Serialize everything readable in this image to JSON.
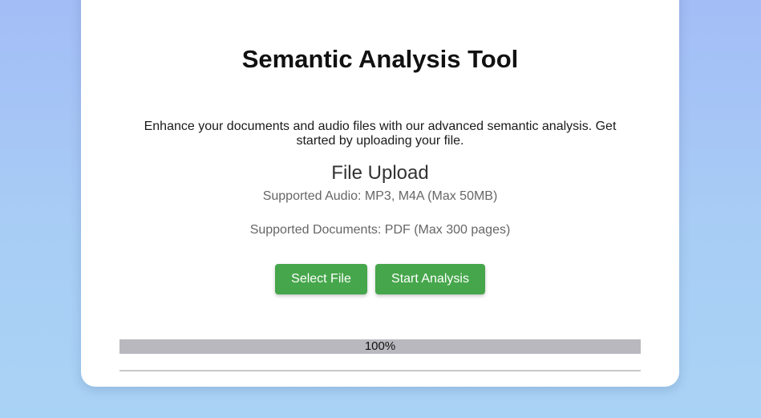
{
  "app": {
    "title": "Semantic Analysis Tool",
    "intro": "Enhance your documents and audio files with our advanced semantic analysis. Get started by uploading your file."
  },
  "upload": {
    "heading": "File Upload",
    "supported_audio": "Supported Audio: MP3, M4A (Max 50MB)",
    "supported_documents": "Supported Documents: PDF (Max 300 pages)",
    "select_label": "Select File",
    "start_label": "Start Analysis"
  },
  "progress": {
    "label": "100%",
    "value": 1.0
  },
  "colors": {
    "accent_button": "#46a64b",
    "progress_bar": "#b9b8bf"
  }
}
